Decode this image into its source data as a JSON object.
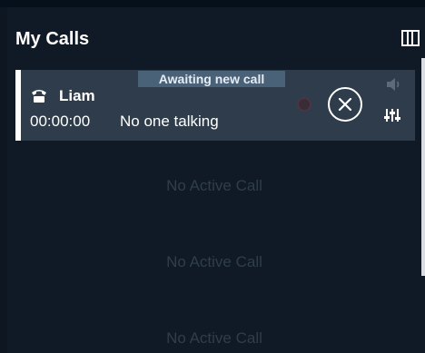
{
  "header": {
    "title": "My Calls",
    "settings_icon": "columns-icon"
  },
  "active_call": {
    "status": "Awaiting new call",
    "caller_icon": "phone-icon",
    "caller_name": "Liam",
    "duration": "00:00:00",
    "talking_status": "No one talking",
    "record_icon": "record-dot-icon",
    "hangup_icon": "close-circle-icon",
    "volume_icon": "speaker-icon",
    "mixer_icon": "mixer-icon"
  },
  "empty_slots": [
    "No Active Call",
    "No Active Call",
    "No Active Call"
  ],
  "colors": {
    "background": "#0e1621",
    "card": "#2e3c4b",
    "badge": "#4a6278",
    "empty_text": "#2f3d4c"
  }
}
